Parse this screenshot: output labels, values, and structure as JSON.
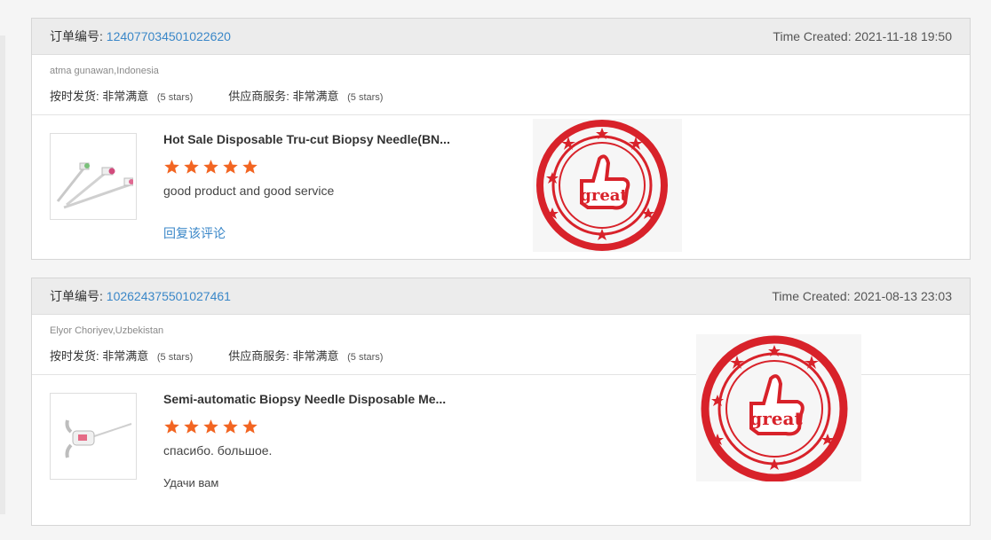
{
  "reviews": [
    {
      "order_label": "订单编号:",
      "order_number": "124077034501022620",
      "time_created": "Time Created: 2021-11-18 19:50",
      "buyer": "atma gunawan,Indonesia",
      "ratings": [
        {
          "label": "按时发货:",
          "value": "非常满意",
          "stars": "(5 stars)"
        },
        {
          "label": "供应商服务:",
          "value": "非常满意",
          "stars": "(5 stars)"
        }
      ],
      "product_title": "Hot Sale Disposable Tru-cut Biopsy Needle(BN...",
      "star_count": 5,
      "review": "good product and good service",
      "reply_link": "回复该评论",
      "stamp_text": "great",
      "product_image": "biopsy-needles-image"
    },
    {
      "order_label": "订单编号:",
      "order_number": "102624375501027461",
      "time_created": "Time Created: 2021-08-13 23:03",
      "buyer": "Elyor Choriyev,Uzbekistan",
      "ratings": [
        {
          "label": "按时发货:",
          "value": "非常满意",
          "stars": "(5 stars)"
        },
        {
          "label": "供应商服务:",
          "value": "非常满意",
          "stars": "(5 stars)"
        }
      ],
      "product_title": "Semi-automatic Biopsy Needle Disposable Me...",
      "star_count": 5,
      "review": "спасибо. большое.",
      "review_2": "Удачи вам",
      "stamp_text": "great",
      "product_image": "semi-automatic-needle-image"
    }
  ],
  "colors": {
    "star": "#f26522",
    "link": "#3a87c8",
    "stamp": "#d8222a"
  }
}
